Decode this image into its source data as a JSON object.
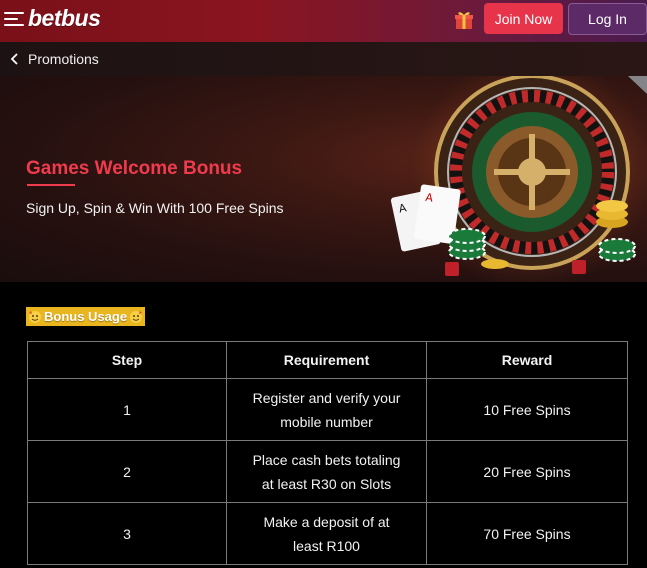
{
  "header": {
    "logo_text": "betbus",
    "join_label": "Join Now",
    "login_label": "Log In",
    "colors": {
      "join": "#e8344a",
      "login": "#5c2a66"
    }
  },
  "breadcrumb": {
    "label": "Promotions"
  },
  "banner": {
    "title": "Games Welcome Bonus",
    "subtitle": "Sign Up, Spin & Win With 100 Free Spins",
    "accent": "#ef3b4d"
  },
  "bonus_usage": {
    "label": "Bonus Usage",
    "color": "#e9b620"
  },
  "table": {
    "headers": [
      "Step",
      "Requirement",
      "Reward"
    ],
    "rows": [
      {
        "step": "1",
        "requirement": "Register and verify your mobile number",
        "reward": "10 Free Spins"
      },
      {
        "step": "2",
        "requirement": "Place cash bets totaling at least R30 on Slots",
        "reward": "20 Free Spins"
      },
      {
        "step": "3",
        "requirement": "Make a deposit of at least R100",
        "reward": "70 Free Spins"
      }
    ]
  }
}
